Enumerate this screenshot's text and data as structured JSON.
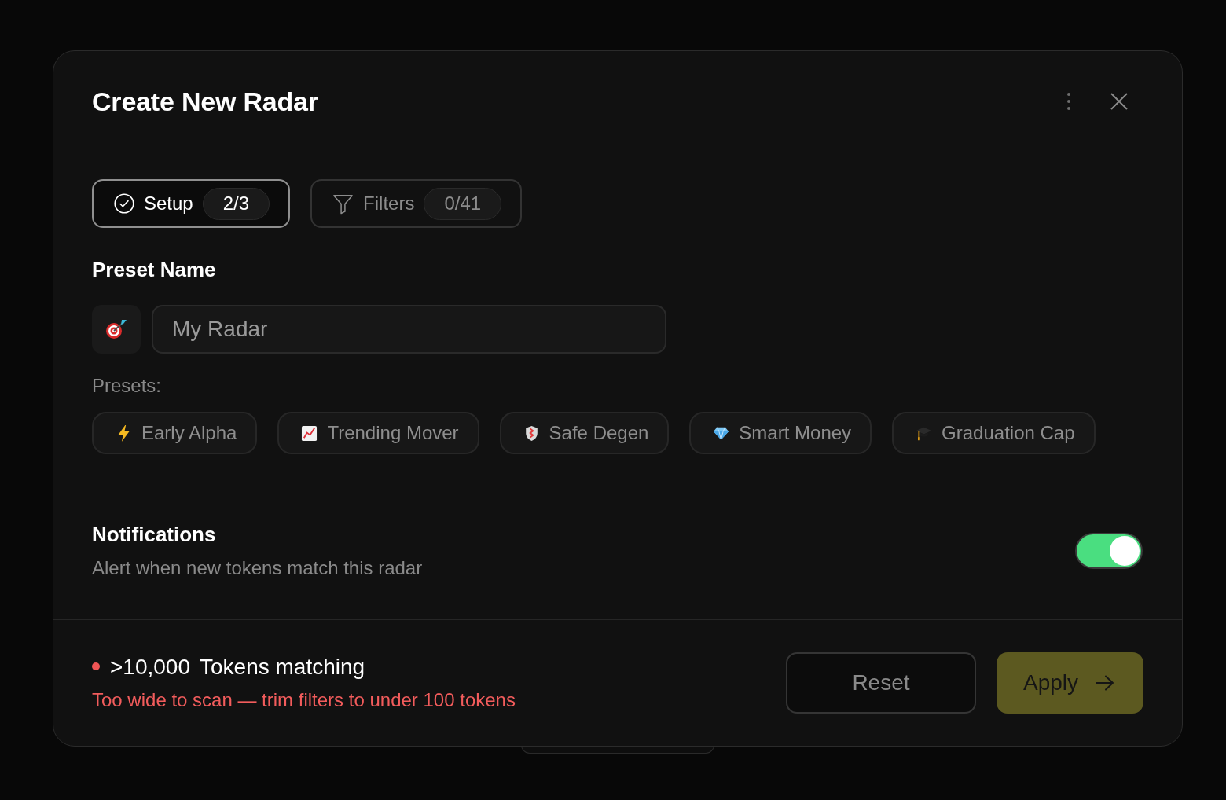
{
  "dialog": {
    "title": "Create New Radar"
  },
  "tabs": [
    {
      "label": "Setup",
      "badge": "2/3",
      "selected": true
    },
    {
      "label": "Filters",
      "badge": "0/41",
      "selected": false
    }
  ],
  "preset_name": {
    "label": "Preset Name",
    "placeholder": "My Radar"
  },
  "presets": {
    "label": "Presets:",
    "items": [
      "Early Alpha",
      "Trending Mover",
      "Safe Degen",
      "Smart Money",
      "Graduation Cap"
    ]
  },
  "notifications": {
    "title": "Notifications",
    "description": "Alert when new tokens match this radar",
    "on": true
  },
  "footer": {
    "count": ">10,000",
    "count_label": "Tokens matching",
    "warning": "Too wide to scan — trim filters to under 100 tokens",
    "buttons": [
      {
        "label": "Reset",
        "kind": "secondary"
      },
      {
        "label": "Apply",
        "kind": "primary"
      }
    ]
  }
}
